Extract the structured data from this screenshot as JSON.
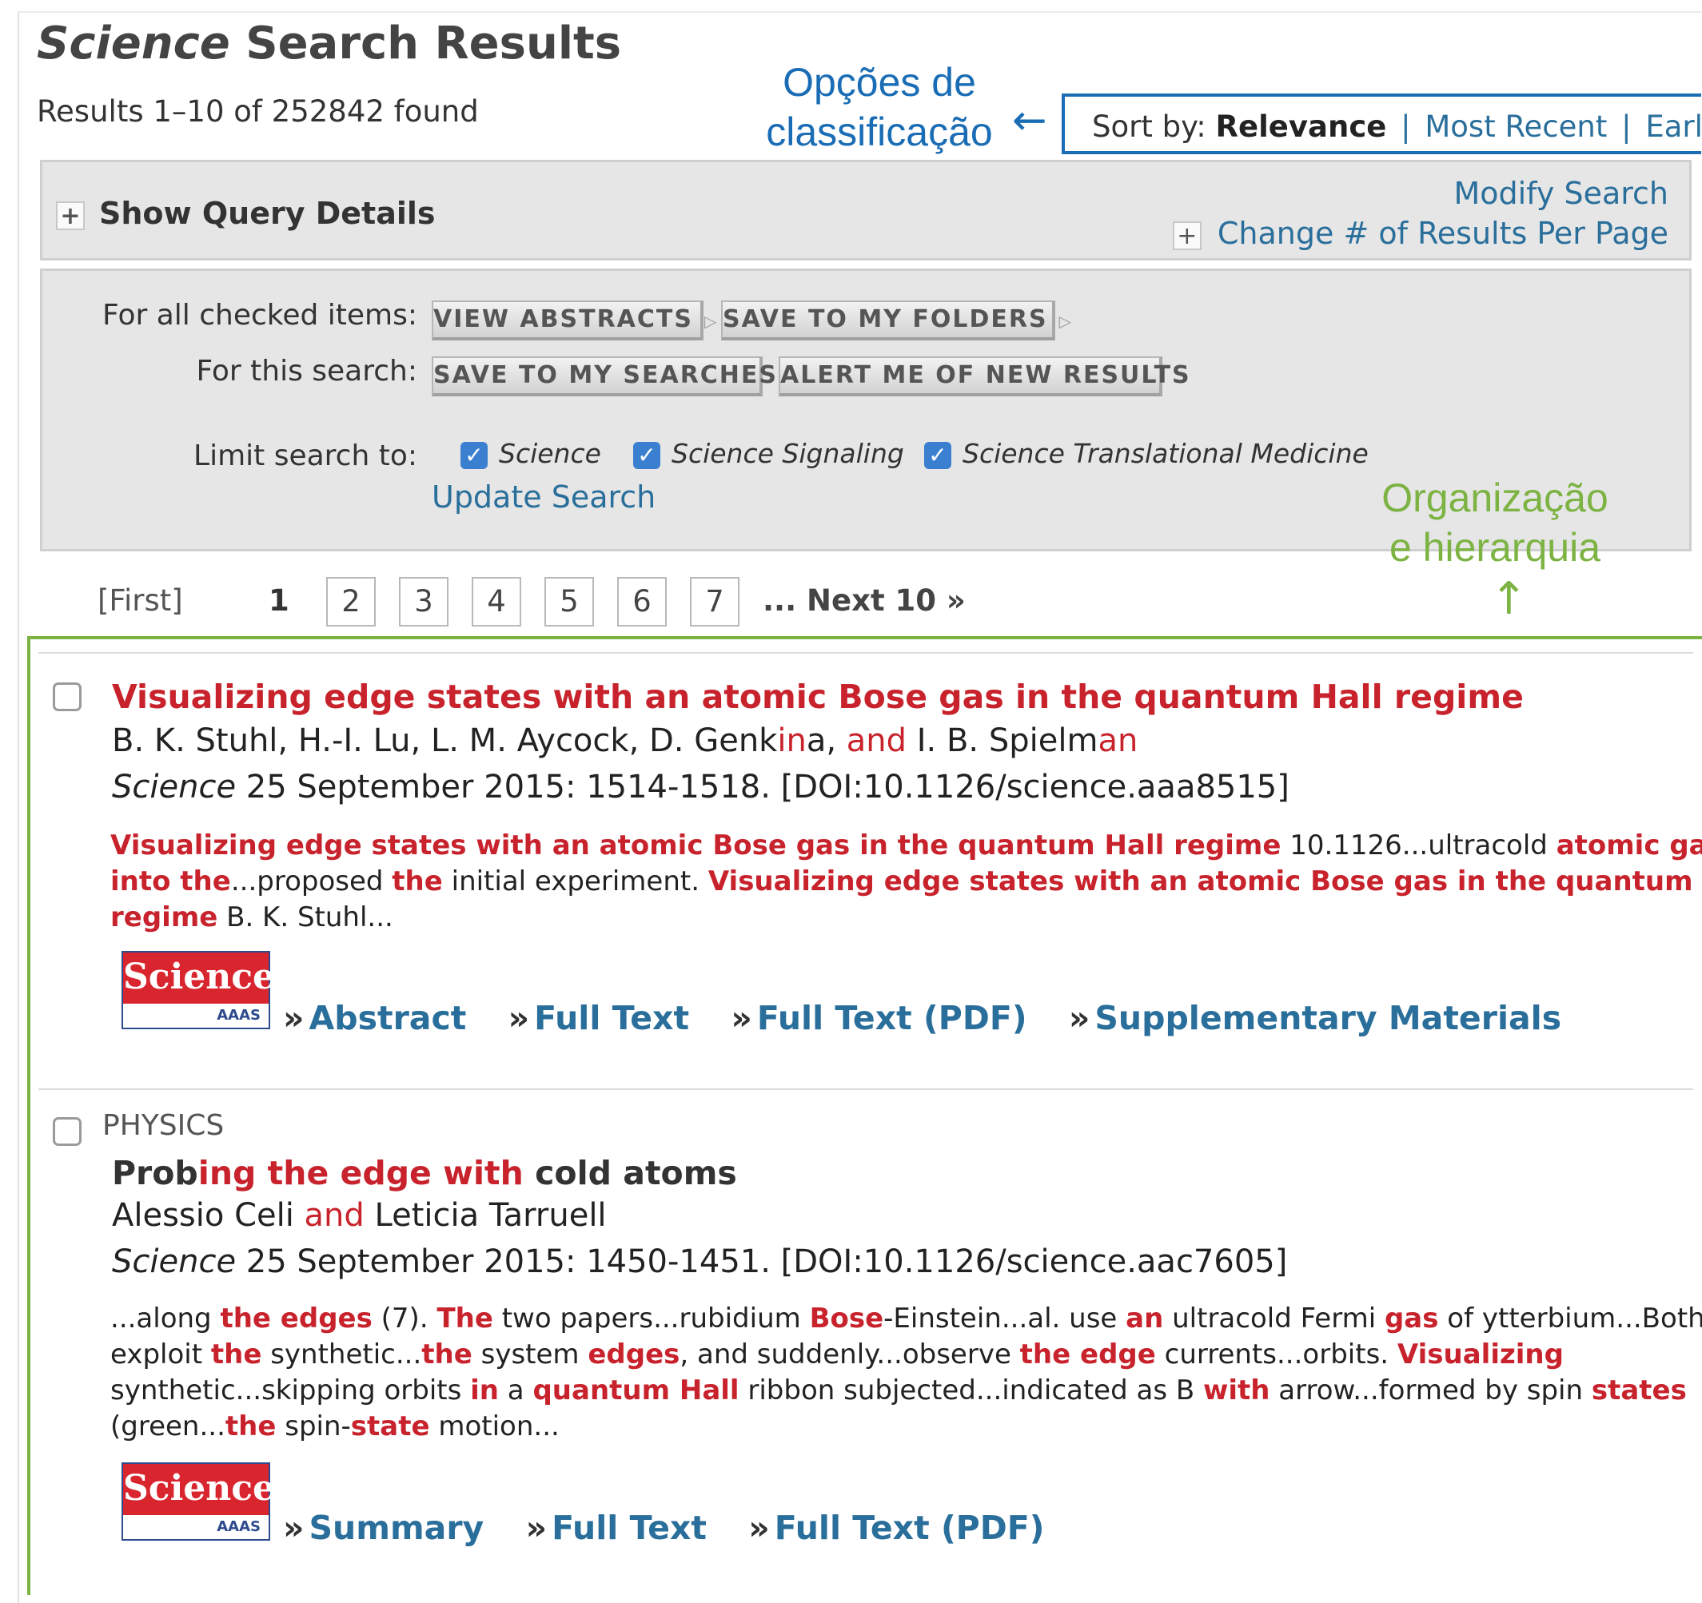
{
  "header": {
    "title_italic": "Science",
    "title_rest": " Search Results",
    "results_count": "Results 1–10 of 252842 found"
  },
  "annotations": {
    "sort_label_line1": "Opções de",
    "sort_label_line2": "classificação",
    "org_label_line1": "Organização",
    "org_label_line2": "e hierarquia",
    "sort_arrow": "←",
    "org_arrow": "↑"
  },
  "sort": {
    "label": "Sort by:",
    "current": "Relevance",
    "options": [
      "Most Recent",
      "Earliest"
    ],
    "separator": "|"
  },
  "query": {
    "plus": "+",
    "show_details": "Show Query Details",
    "modify_search": "Modify Search",
    "change_results": "Change # of Results Per Page"
  },
  "actions": {
    "checked_label": "For all checked items:",
    "search_label": "For this search:",
    "view_abstracts": "VIEW ABSTRACTS",
    "save_folders": "SAVE TO MY FOLDERS",
    "save_searches": "SAVE TO MY SEARCHES",
    "alert_new": "ALERT ME OF NEW RESULTS",
    "arrow": "▷",
    "limit_label": "Limit search to:",
    "limit_options": [
      "Science",
      "Science Signaling",
      "Science Translational Medicine"
    ],
    "check_glyph": "✓",
    "update_search": "Update Search"
  },
  "pagination": {
    "first": "[First]",
    "current": "1",
    "pages": [
      "2",
      "3",
      "4",
      "5",
      "6",
      "7"
    ],
    "next": "... Next 10 »"
  },
  "results": [
    {
      "title": "Visualizing edge states with an atomic Bose gas in the quantum Hall regime",
      "authors": [
        "B. K. Stuhl, H.-I. Lu, L. M. Aycock, D. Genk",
        "in",
        "a, ",
        "and",
        " I. B. Spielm",
        "an"
      ],
      "journal": "Science",
      "citation": " 25 September 2015: 1514-1518. [DOI:10.1126/science.aaa8515]",
      "snippet": [
        [
          "Visualizing edge states with an atomic Bose gas in the quantum Hall regime",
          " 10.1126...ultracold ",
          "atomic gases"
        ],
        [
          "into the",
          "...proposed ",
          "the",
          " initial experiment. ",
          "Visualizing edge states with an atomic Bose gas in the quantum Hall"
        ],
        [
          "regime",
          " B. K. Stuhl..."
        ]
      ],
      "links": [
        "Abstract",
        "Full Text",
        "Full Text (PDF)",
        "Supplementary Materials"
      ]
    },
    {
      "section": "PHYSICS",
      "title_parts": [
        "Prob",
        "ing",
        " ",
        "the edge with",
        " cold atoms"
      ],
      "authors": [
        "Alessio Celi ",
        "and",
        " Leticia Tarruell"
      ],
      "journal": "Science",
      "citation": " 25 September 2015: 1450-1451. [DOI:10.1126/science.aac7605]",
      "snippet": [
        [
          "...along ",
          "the edges",
          " (7). ",
          "The",
          " two papers...rubidium ",
          "Bose",
          "-Einstein...al. use ",
          "an",
          " ultracold Fermi ",
          "gas",
          " of ytterbium...Both"
        ],
        [
          "exploit ",
          "the",
          " synthetic...",
          "the",
          " system ",
          "edges",
          ", and suddenly...observe ",
          "the edge",
          " currents...orbits. ",
          "Visualizing"
        ],
        [
          "synthetic...skipping orbits ",
          "in",
          " a ",
          "quantum Hall",
          " ribbon subjected...indicated as B ",
          "with",
          " arrow...formed by spin ",
          "states"
        ],
        [
          "(green...",
          "the",
          " spin-",
          "state",
          " motion..."
        ]
      ],
      "links": [
        "Summary",
        "Full Text",
        "Full Text (PDF)"
      ]
    }
  ],
  "logo": {
    "name": "Science",
    "publisher": "AAAS"
  },
  "link_prefix": "»",
  "colors": {
    "accent_blue": "#1a6db5",
    "link_blue": "#2a6f9b",
    "highlight_red": "#c8232c",
    "annotation_green": "#7cb342",
    "panel_gray": "#e6e6e6"
  }
}
